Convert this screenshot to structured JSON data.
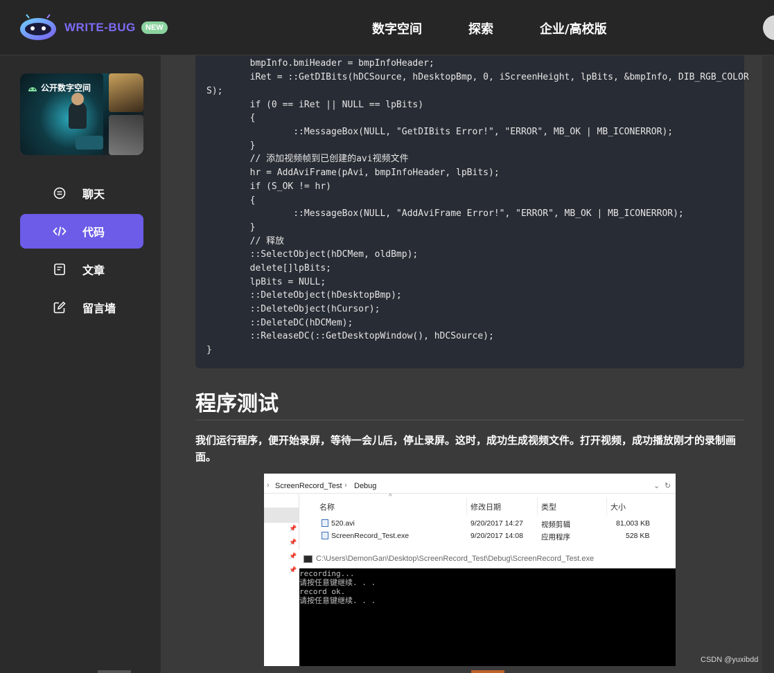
{
  "header": {
    "brand": "WRITE-BUG",
    "badge": "NEW",
    "nav": [
      "数字空间",
      "探索",
      "企业/高校版"
    ]
  },
  "sidebar": {
    "promo_label": "公开数字空间",
    "items": [
      {
        "label": "聊天",
        "icon": "chat-icon",
        "active": false
      },
      {
        "label": "代码",
        "icon": "code-icon",
        "active": true
      },
      {
        "label": "文章",
        "icon": "article-icon",
        "active": false
      },
      {
        "label": "留言墙",
        "icon": "edit-icon",
        "active": false
      }
    ]
  },
  "code_lines": [
    "        bmpInfo.bmiHeader = bmpInfoHeader;",
    "        iRet = ::GetDIBits(hDCSource, hDesktopBmp, 0, iScreenHeight, lpBits, &bmpInfo, DIB_RGB_COLOR",
    "S);",
    "        if (0 == iRet || NULL == lpBits)",
    "        {",
    "                ::MessageBox(NULL, \"GetDIBits Error!\", \"ERROR\", MB_OK | MB_ICONERROR);",
    "        }",
    "        // 添加视频帧到已创建的avi视频文件",
    "        hr = AddAviFrame(pAvi, bmpInfoHeader, lpBits);",
    "        if (S_OK != hr)",
    "        {",
    "                ::MessageBox(NULL, \"AddAviFrame Error!\", \"ERROR\", MB_OK | MB_ICONERROR);",
    "        }",
    "        // 释放",
    "        ::SelectObject(hDCMem, oldBmp);",
    "        delete[]lpBits;",
    "        lpBits = NULL;",
    "        ::DeleteObject(hDesktopBmp);",
    "        ::DeleteObject(hCursor);",
    "        ::DeleteDC(hDCMem);",
    "        ::ReleaseDC(::GetDesktopWindow(), hDCSource);",
    "}"
  ],
  "article": {
    "heading": "程序测试",
    "paragraph": "我们运行程序，便开始录屏，等待一会儿后，停止录屏。这时，成功生成视频文件。打开视频，成功播放刚才的录制画面。"
  },
  "screenshot": {
    "breadcrumb": [
      "ScreenRecord_Test",
      "Debug"
    ],
    "columns": [
      "名称",
      "修改日期",
      "类型",
      "大小"
    ],
    "files": [
      {
        "name": "520.avi",
        "date": "9/20/2017 14:27",
        "type": "视频剪辑",
        "size": "81,003 KB"
      },
      {
        "name": "ScreenRecord_Test.exe",
        "date": "9/20/2017 14:08",
        "type": "应用程序",
        "size": "528 KB"
      }
    ],
    "console_title": "C:\\Users\\DemonGan\\Desktop\\ScreenRecord_Test\\Debug\\ScreenRecord_Test.exe",
    "console_output": "recording...\n请按任意键继续. . .\nrecord ok.\n请按任意键继续. . ."
  },
  "watermark": "CSDN @yuxibdd",
  "colors": {
    "accent": "#6c5ce7",
    "badge": "#8bd3a0",
    "code_bg": "#282c34"
  }
}
